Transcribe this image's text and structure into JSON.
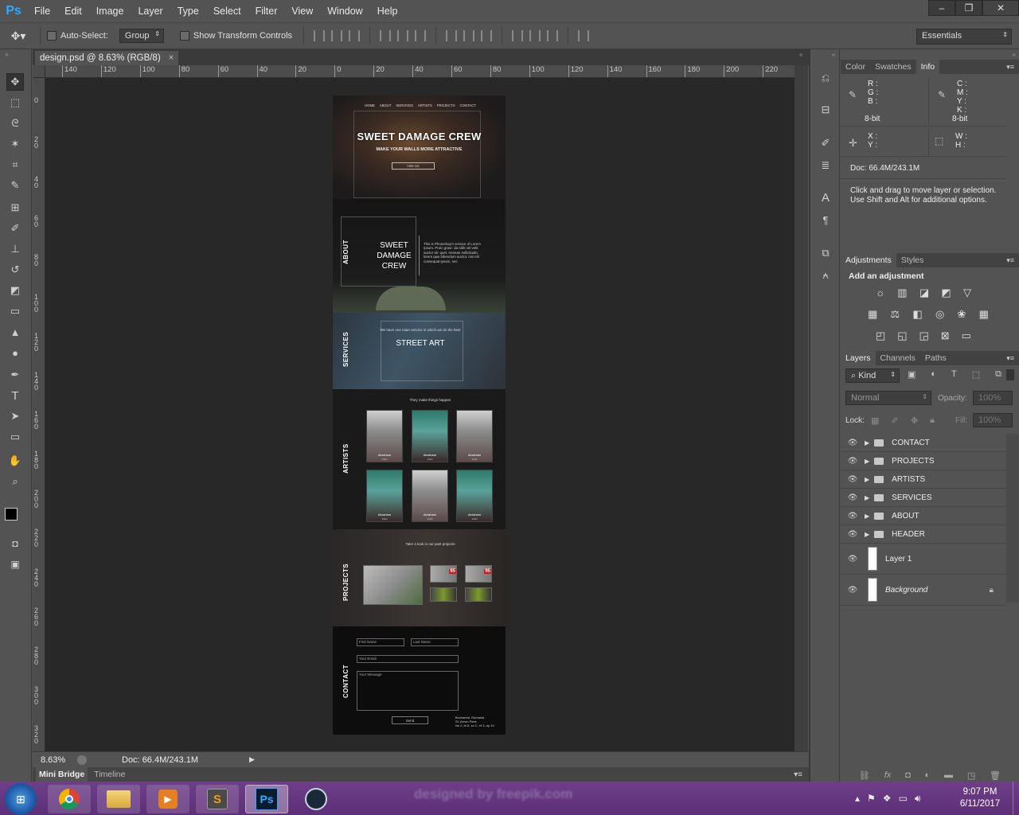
{
  "app": {
    "logo": "Ps",
    "menu": [
      "File",
      "Edit",
      "Image",
      "Layer",
      "Type",
      "Select",
      "Filter",
      "View",
      "Window",
      "Help"
    ]
  },
  "window_controls": {
    "minimize": "–",
    "restore": "❐",
    "close": "✕"
  },
  "options_bar": {
    "auto_select_label": "Auto-Select:",
    "auto_select_value": "Group",
    "transform_label": "Show Transform Controls",
    "workspace": "Essentials"
  },
  "document": {
    "tab_title": "design.psd @ 8.63% (RGB/8)",
    "tab_close": "×",
    "zoom": "8.63%",
    "doc_size": "Doc: 66.4M/243.1M"
  },
  "rulers": {
    "top": [
      "140",
      "120",
      "100",
      "80",
      "60",
      "40",
      "20",
      "0",
      "20",
      "40",
      "60",
      "80",
      "100",
      "120",
      "140",
      "160",
      "180",
      "200",
      "220"
    ],
    "left": [
      "0",
      "20",
      "40",
      "60",
      "80",
      "100",
      "120",
      "140",
      "160",
      "180",
      "200",
      "220",
      "240",
      "260",
      "280",
      "300",
      "320"
    ]
  },
  "mini_bridge": {
    "tabs": [
      "Mini Bridge",
      "Timeline"
    ]
  },
  "design": {
    "nav": [
      "HOME",
      "ABOUT",
      "SERVICES",
      "ARTISTS",
      "PROJECTS",
      "CONTACT"
    ],
    "hero_title": "SWEET DAMAGE CREW",
    "hero_subtitle": "MAKE YOUR WALLS MORE ATTRACTIVE",
    "hero_button": "Hire Us",
    "about_label": "ABOUT",
    "about_title_1": "SWEET",
    "about_title_2": "DAMAGE",
    "about_title_3": "CREW",
    "about_text": "This is Photoshop's version of Lorem Ipsum. Proin gravi- da nibh vel velit auctor ali- quet. Aenean sollicitudin, lorem quis bibendum auctor, nisi elit consequat ipsum, nec",
    "services_label": "SERVICES",
    "services_intro": "We have one main service in which we do the best",
    "services_title": "STREET ART",
    "artists_label": "ARTISTS",
    "artists_intro": "They make things happen",
    "artists": [
      {
        "name": "Abraham",
        "role": "Artist"
      },
      {
        "name": "Abraham",
        "role": "Artist"
      },
      {
        "name": "Abraham",
        "role": "Artist"
      },
      {
        "name": "Abraham",
        "role": "Artist"
      },
      {
        "name": "Abraham",
        "role": "Artist"
      },
      {
        "name": "Abraham",
        "role": "Artist"
      }
    ],
    "projects_label": "PROJECTS",
    "projects_intro": "Take a look in our past projects",
    "project_badge": "95",
    "contact_label": "CONTACT",
    "contact_fields": {
      "first": "First Name",
      "last": "Last Name",
      "email": "Your Email",
      "message": "Your Message"
    },
    "contact_button": "Send",
    "contact_address": [
      "Bucharest, Romania",
      "St. Aeron Pane",
      "No 2, bl A, sc C, et 3, ap 10"
    ]
  },
  "info_panel": {
    "tabs": [
      "Color",
      "Swatches",
      "Info"
    ],
    "rgb": [
      "R :",
      "G :",
      "B :"
    ],
    "cmyk": [
      "C :",
      "M :",
      "Y :",
      "K :"
    ],
    "bit_left": "8-bit",
    "bit_right": "8-bit",
    "xy": [
      "X :",
      "Y :"
    ],
    "wh": [
      "W :",
      "H :"
    ],
    "doc": "Doc: 66.4M/243.1M",
    "hint_1": "Click and drag to move layer or selection.",
    "hint_2": "Use Shift and Alt for additional options."
  },
  "adjustments_panel": {
    "tabs": [
      "Adjustments",
      "Styles"
    ],
    "title": "Add an adjustment"
  },
  "layers_panel": {
    "tabs": [
      "Layers",
      "Channels",
      "Paths"
    ],
    "kind": "Kind",
    "blend": "Normal",
    "opacity_label": "Opacity:",
    "opacity_value": "100%",
    "lock_label": "Lock:",
    "fill_label": "Fill:",
    "fill_value": "100%",
    "groups": [
      "CONTACT",
      "PROJECTS",
      "ARTISTS",
      "SERVICES",
      "ABOUT",
      "HEADER"
    ],
    "layers": [
      "Layer 1",
      "Background"
    ]
  },
  "taskbar": {
    "time": "9:07 PM",
    "date": "6/11/2017",
    "watermark": "designed by freepik.com"
  },
  "colors": {
    "ps_blue": "#31a8ff",
    "ui_gray": "#535353",
    "canvas_dark": "#282828",
    "taskbar_purple": "#5d2f78"
  }
}
